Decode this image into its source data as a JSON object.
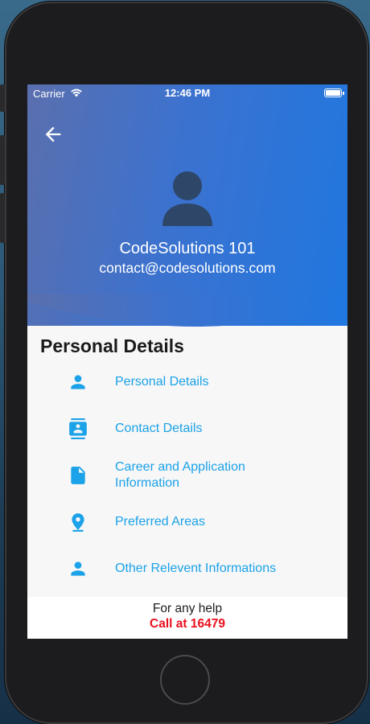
{
  "status_bar": {
    "carrier": "Carrier",
    "time": "12:46 PM"
  },
  "profile": {
    "name": "CodeSolutions 101",
    "email": "contact@codesolutions.com"
  },
  "section": {
    "title": "Personal Details"
  },
  "menu": {
    "items": [
      {
        "label": "Personal Details",
        "icon": "person-icon"
      },
      {
        "label": "Contact Details",
        "icon": "contact-card-icon"
      },
      {
        "label": "Career and Application Information",
        "icon": "document-icon"
      },
      {
        "label": "Preferred Areas",
        "icon": "location-pin-icon"
      },
      {
        "label": "Other Relevent Informations",
        "icon": "person-icon"
      }
    ]
  },
  "footer": {
    "help_text": "For any help",
    "call_text": "Call at 16479"
  },
  "colors": {
    "header_gradient_start": "#5a6fae",
    "header_gradient_end": "#1f77e0",
    "accent": "#1ba2e8",
    "call_red": "#e8101e"
  }
}
